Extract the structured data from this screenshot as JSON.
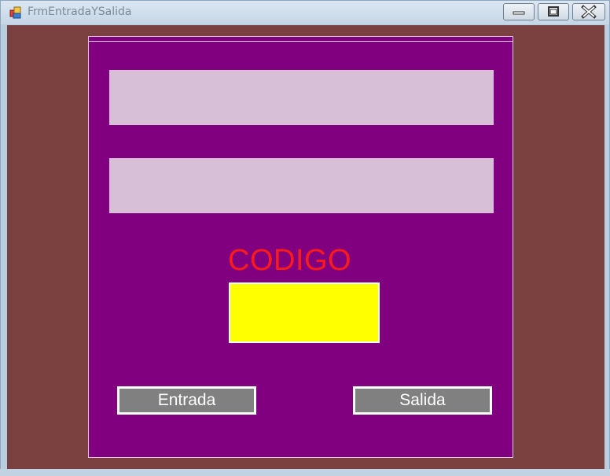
{
  "window": {
    "title": "FrmEntradaYSalida",
    "controls": [
      "minimize-icon",
      "maximize-icon",
      "close-icon"
    ]
  },
  "form": {
    "code_label": "CODIGO",
    "field_1_value": "",
    "field_2_value": "",
    "code_value": "",
    "entrada_label": "Entrada",
    "salida_label": "Salida"
  },
  "colors": {
    "form_background": "#7b4040",
    "panel_background": "#800080",
    "field_background": "#d8bfd8",
    "code_label_color": "#ff1a1a",
    "code_input_background": "#ffff00",
    "button_background": "#808080"
  }
}
